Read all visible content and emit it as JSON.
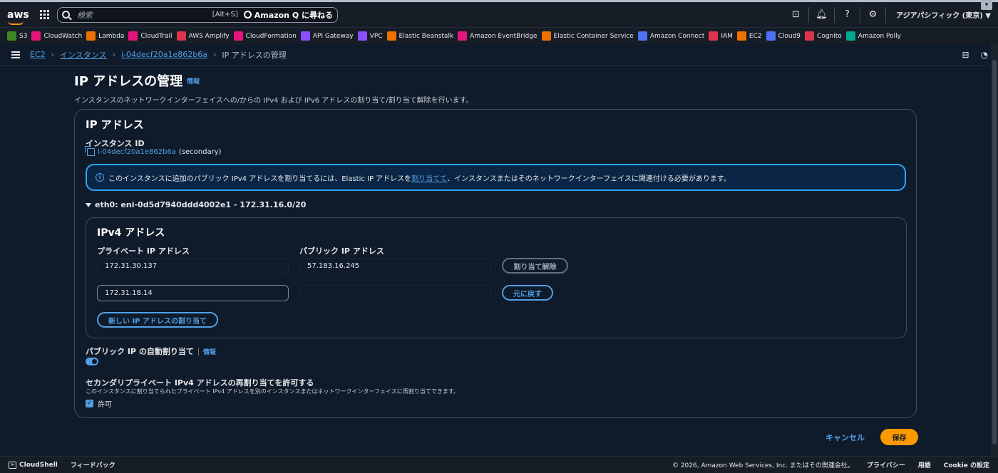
{
  "topbar": {
    "logo": "aws",
    "search_placeholder": "検索",
    "search_shortcut": "[Alt+S]",
    "amazon_q": "Amazon Q に尋ねる",
    "region": "アジアパシフィック (東京) ▼",
    "icons": [
      "cloudshell-icon",
      "bell-icon",
      "help-icon",
      "gear-icon"
    ]
  },
  "favorites": [
    {
      "label": "S3",
      "color": "#3f8624"
    },
    {
      "label": "CloudWatch",
      "color": "#e7157b"
    },
    {
      "label": "Lambda",
      "color": "#ed7100"
    },
    {
      "label": "CloudTrail",
      "color": "#e7157b"
    },
    {
      "label": "AWS Amplify",
      "color": "#dd344c"
    },
    {
      "label": "CloudFormation",
      "color": "#e7157b"
    },
    {
      "label": "API Gateway",
      "color": "#8c4fff"
    },
    {
      "label": "VPC",
      "color": "#8c4fff"
    },
    {
      "label": "Elastic Beanstalk",
      "color": "#ed7100"
    },
    {
      "label": "Amazon EventBridge",
      "color": "#e7157b"
    },
    {
      "label": "Elastic Container Service",
      "color": "#ed7100"
    },
    {
      "label": "Amazon Connect",
      "color": "#4d72f3"
    },
    {
      "label": "IAM",
      "color": "#dd344c"
    },
    {
      "label": "EC2",
      "color": "#ed7100"
    },
    {
      "label": "Cloud9",
      "color": "#4d72f3"
    },
    {
      "label": "Cognito",
      "color": "#dd344c"
    },
    {
      "label": "Amazon Polly",
      "color": "#01a88d"
    }
  ],
  "breadcrumb": {
    "items": [
      "EC2",
      "インスタンス",
      "i-04decf20a1e862b6a"
    ],
    "current": "IP アドレスの管理"
  },
  "page": {
    "title": "IP アドレスの管理",
    "info": "情報",
    "description": "インスタンスのネットワークインターフェイスへの/からの IPv4 および IPv6 アドレスの割り当て/割り当て解除を行います。"
  },
  "card": {
    "title": "IP アドレス",
    "instance_id_label": "インスタンス ID",
    "instance_id": "i-04decf20a1e862b6a",
    "instance_suffix": "(secondary)",
    "alert_pre": "このインスタンスに追加のパブリック IPv4 アドレスを割り当てるには、Elastic IP アドレスを",
    "alert_link": "割り当てて",
    "alert_post": "、インスタンスまたはそのネットワークインターフェイスに関連付ける必要があります。",
    "eth": "eth0: eni-0d5d7940ddd4002e1 - 172.31.16.0/20"
  },
  "ipv4": {
    "title": "IPv4 アドレス",
    "private_label": "プライベート IP アドレス",
    "public_label": "パブリック IP アドレス",
    "rows": [
      {
        "private": "172.31.30.137",
        "public": "57.183.16.245",
        "action": "割り当て解除"
      },
      {
        "private": "172.31.18.14",
        "public": "",
        "action": "元に戻す"
      }
    ],
    "assign_new": "新しい IP アドレスの割り当て"
  },
  "auto_assign": {
    "label": "パブリック IP の自動割り当て",
    "info": "情報",
    "enabled": true
  },
  "secondary": {
    "label": "セカンダリプライベート IPv4 アドレスの再割り当てを許可する",
    "description": "このインスタンスに割り当てられたプライベート IPv4 アドレスを別のインスタンスまたはネットワークインターフェイスに再割り当てできます。",
    "checkbox_label": "許可",
    "checked": true
  },
  "actions": {
    "cancel": "キャンセル",
    "save": "保存"
  },
  "footer": {
    "cloudshell": "CloudShell",
    "feedback": "フィードバック",
    "copyright": "© 2026, Amazon Web Services, Inc. またはその関連会社。",
    "privacy": "プライバシー",
    "terms": "用語",
    "cookie": "Cookie の設定"
  }
}
